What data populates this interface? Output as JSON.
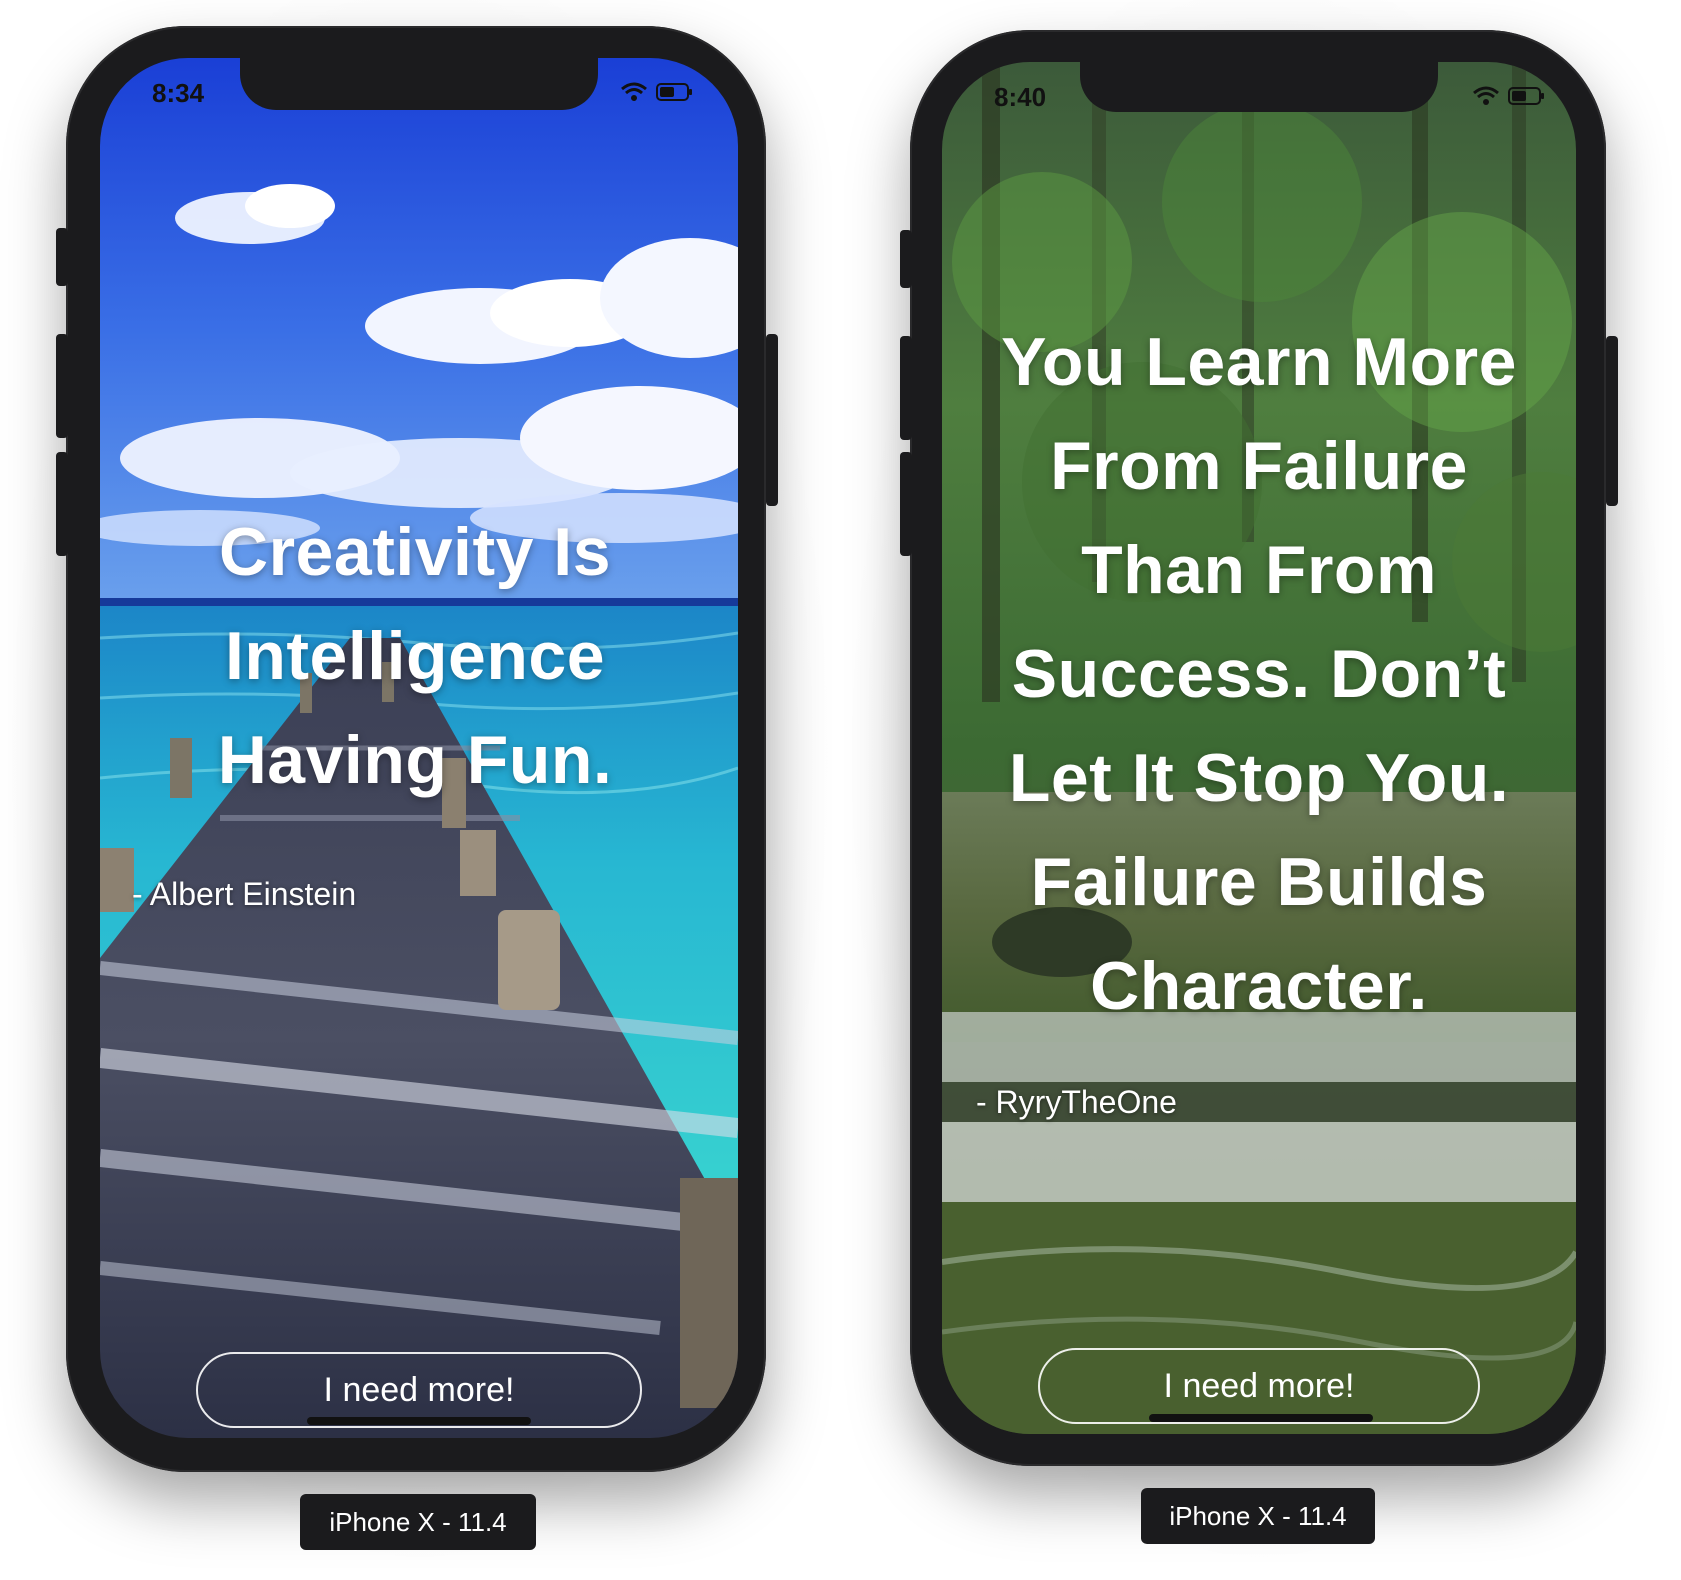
{
  "devices": [
    {
      "label": "iPhone X - 11.4",
      "status_time": "8:34",
      "quote": "Creativity Is Intelligence Having Fun.",
      "author": "- Albert Einstein",
      "button_label": "I need more!",
      "background": "pier"
    },
    {
      "label": "iPhone X - 11.4",
      "status_time": "8:40",
      "quote": "You Learn More From Failure Than From Success. Don’t Let It Stop You. Failure Builds Character.",
      "author": "- RyryTheOne",
      "button_label": "I need more!",
      "background": "forest"
    }
  ],
  "colors": {
    "device_frame": "#1b1b1d",
    "text": "#ffffff"
  }
}
